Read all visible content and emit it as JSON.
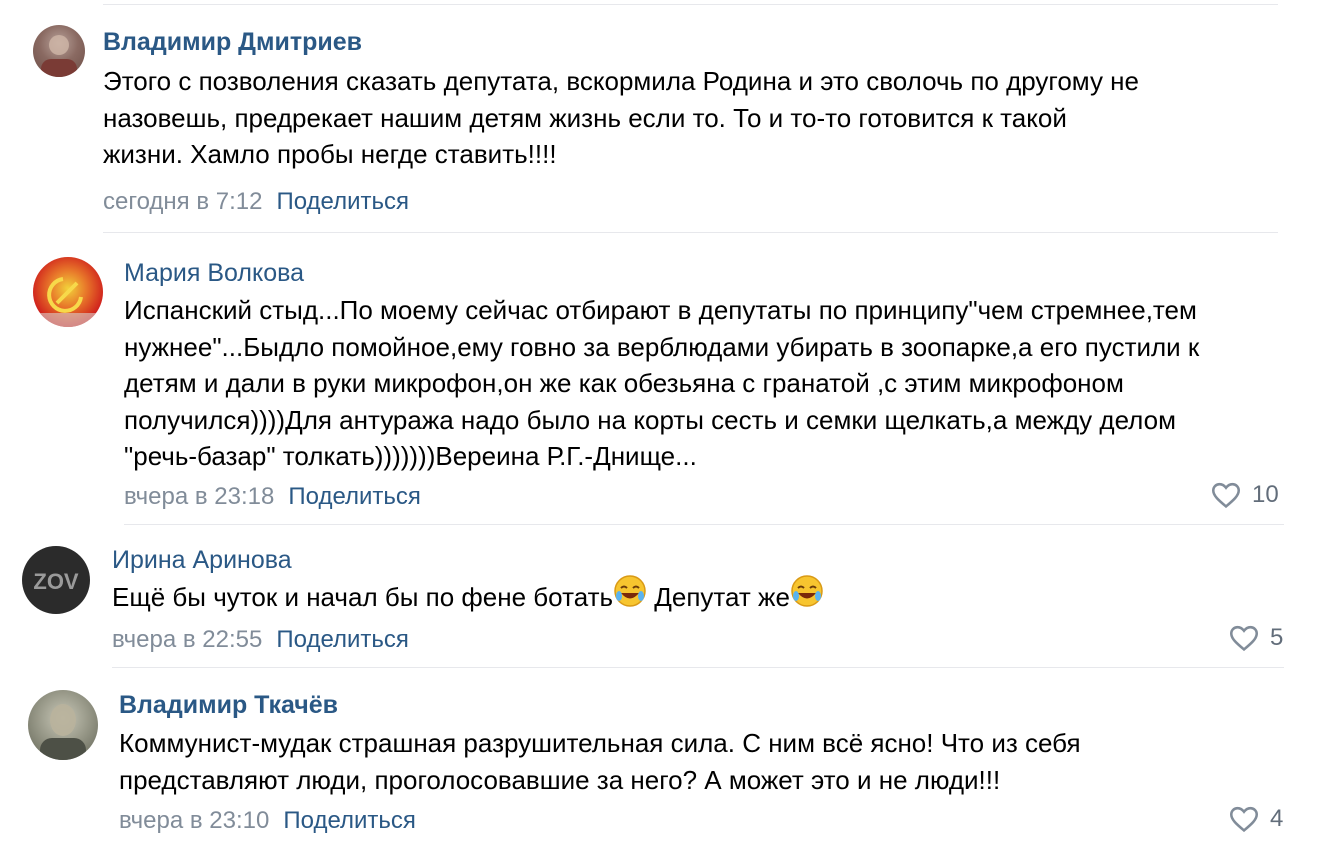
{
  "comments": [
    {
      "author": "Владимир Дмитриев",
      "text_lines": [
        "Этого с позволения сказать депутата, вскормила Родина и это сволочь по другому не",
        "назовешь, предрекает нашим детям жизнь если то. То и то-то готовится к такой",
        "жизни. Хамло пробы негде ставить!!!!"
      ],
      "date": "сегодня в 7:12",
      "share": "Поделиться",
      "likes": null
    },
    {
      "author": "Мария Волкова",
      "text_lines": [
        "Испанский стыд...По моему сейчас отбирают в депутаты по принципу\"чем стремнее,тем",
        "нужнее\"...Быдло помойное,ему говно за верблюдами убирать в зоопарке,а его пустили к",
        "детям и дали в руки микрофон,он же как обезьяна с гранатой ,с этим микрофоном",
        "получился))))Для антуража надо было на корты сесть и семки щелкать,а между делом",
        "\"речь-базар\" толкать)))))))Вереина Р.Г.-Днище..."
      ],
      "date": "вчера в 23:18",
      "share": "Поделиться",
      "likes": "10"
    },
    {
      "author": "Ирина Аринова",
      "text_parts": [
        "Ещё бы чуток и начал бы по фене ботать",
        " Депутат же"
      ],
      "date": "вчера в 22:55",
      "share": "Поделиться",
      "likes": "5"
    },
    {
      "author": "Владимир Ткачёв",
      "text_lines": [
        "Коммунист-мудак страшная разрушительная сила. С ним всё ясно! Что из себя",
        "представляют люди, проголосовавшие за него? А может это и не люди!!!"
      ],
      "date": "вчера в 23:10",
      "share": "Поделиться",
      "likes": "4"
    }
  ],
  "avatars": {
    "c3_badge": "ZOV"
  },
  "icons": {
    "like": "heart-outline-icon",
    "emoji": "rolling-on-floor-laughing-emoji"
  },
  "colors": {
    "author": "#2a5885",
    "date": "#818c99",
    "share": "#2a5885",
    "divider": "#e7e8ec",
    "likes": "#626d7a"
  }
}
